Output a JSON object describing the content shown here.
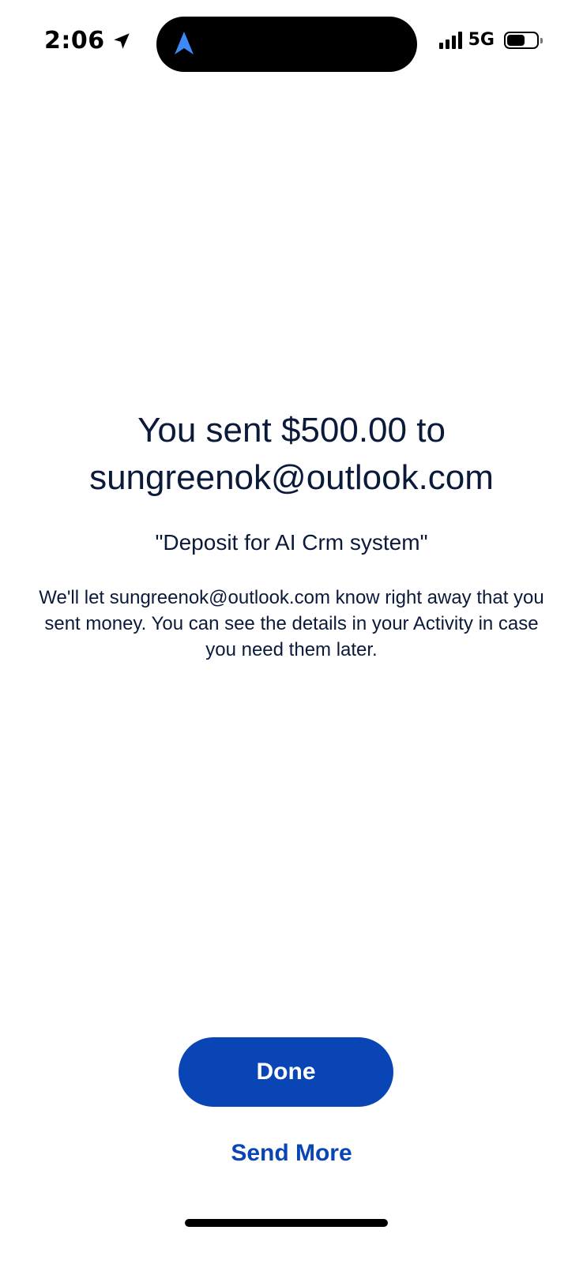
{
  "status_bar": {
    "time": "2:06",
    "location_icon": "location-arrow-icon",
    "island_icon": "navigation-arrow-icon",
    "network": "5G",
    "signal_icon": "signal-bars-icon",
    "battery_icon": "battery-icon",
    "battery_level": 0.6,
    "island_icon_color": "#3d8af7"
  },
  "confirmation": {
    "headline": "You sent $500.00 to sungreenok@outlook.com",
    "note": "\"Deposit for AI Crm system\"",
    "description": "We'll let sungreenok@outlook.com know right away that you sent money. You can see the details in your Activity in case you need them later."
  },
  "actions": {
    "done_label": "Done",
    "send_more_label": "Send More"
  },
  "colors": {
    "primary": "#0a45b5",
    "text": "#0b1a3a",
    "background": "#ffffff"
  }
}
